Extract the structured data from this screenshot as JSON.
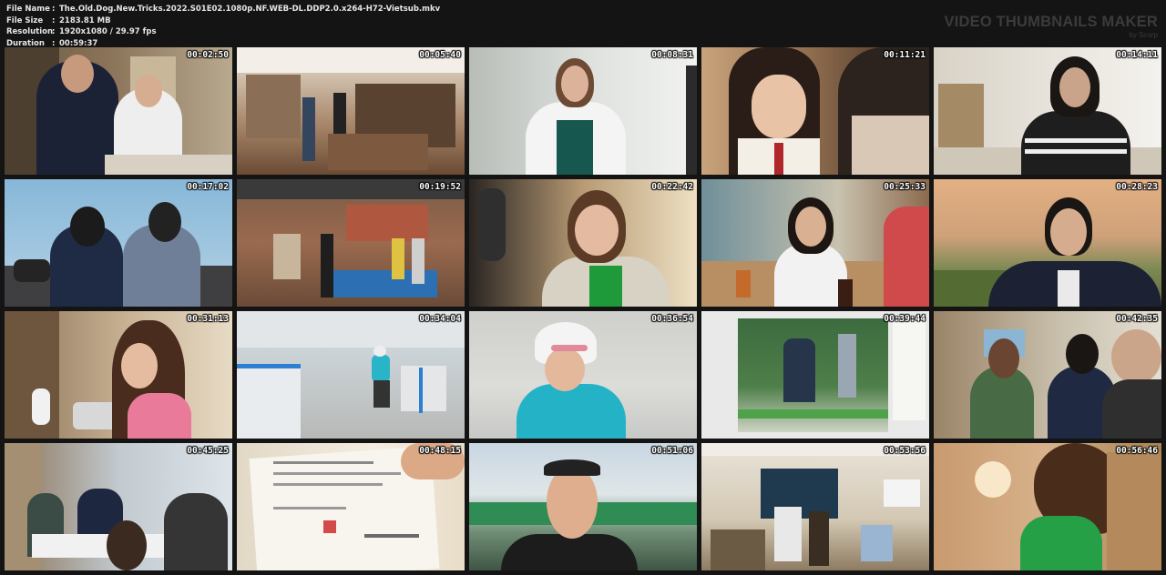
{
  "file_info": [
    {
      "key": "File Name",
      "value": "The.Old.Dog.New.Tricks.2022.S01E02.1080p.NF.WEB-DL.DDP2.0.x264-H72-Vietsub.mkv"
    },
    {
      "key": "File Size",
      "value": "2183.81 MB"
    },
    {
      "key": "Resolution",
      "value": "1920x1080 / 29.97 fps"
    },
    {
      "key": "Duration",
      "value": "00:59:37"
    }
  ],
  "brand": {
    "title": "VIDEO THUMBNAILS MAKER",
    "byline": "by Scorp"
  },
  "thumbnails": [
    {
      "time": "00:02:50"
    },
    {
      "time": "00:05:40"
    },
    {
      "time": "00:08:31"
    },
    {
      "time": "00:11:21"
    },
    {
      "time": "00:14:11"
    },
    {
      "time": "00:17:02"
    },
    {
      "time": "00:19:52"
    },
    {
      "time": "00:22:42"
    },
    {
      "time": "00:25:33"
    },
    {
      "time": "00:28:23"
    },
    {
      "time": "00:31:13"
    },
    {
      "time": "00:34:04"
    },
    {
      "time": "00:36:54"
    },
    {
      "time": "00:39:44"
    },
    {
      "time": "00:42:35"
    },
    {
      "time": "00:45:25"
    },
    {
      "time": "00:48:15"
    },
    {
      "time": "00:51:06"
    },
    {
      "time": "00:53:56"
    },
    {
      "time": "00:56:46"
    }
  ],
  "colors": {
    "background": "#141414",
    "info_text": "#e6e6e6",
    "brand_text": "#3b3b3b"
  }
}
